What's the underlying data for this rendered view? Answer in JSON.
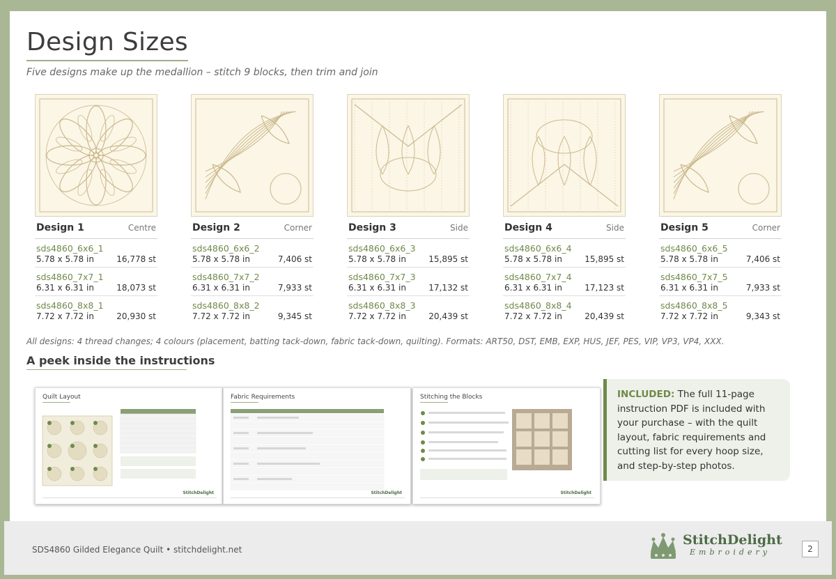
{
  "page": {
    "title": "Design Sizes",
    "subtitle": "Five designs make up the medallion – stitch 9 blocks, then trim and join"
  },
  "designs": [
    {
      "name": "Design 1",
      "role": "Centre",
      "sizes": [
        {
          "code": "sds4860_6x6_1",
          "dims": "5.78 x 5.78 in",
          "stitches": "16,778 st"
        },
        {
          "code": "sds4860_7x7_1",
          "dims": "6.31 x 6.31 in",
          "stitches": "18,073 st"
        },
        {
          "code": "sds4860_8x8_1",
          "dims": "7.72 x 7.72 in",
          "stitches": "20,930 st"
        }
      ]
    },
    {
      "name": "Design 2",
      "role": "Corner",
      "sizes": [
        {
          "code": "sds4860_6x6_2",
          "dims": "5.78 x 5.78 in",
          "stitches": "7,406 st"
        },
        {
          "code": "sds4860_7x7_2",
          "dims": "6.31 x 6.31 in",
          "stitches": "7,933 st"
        },
        {
          "code": "sds4860_8x8_2",
          "dims": "7.72 x 7.72 in",
          "stitches": "9,345 st"
        }
      ]
    },
    {
      "name": "Design 3",
      "role": "Side",
      "sizes": [
        {
          "code": "sds4860_6x6_3",
          "dims": "5.78 x 5.78 in",
          "stitches": "15,895 st"
        },
        {
          "code": "sds4860_7x7_3",
          "dims": "6.31 x 6.31 in",
          "stitches": "17,132 st"
        },
        {
          "code": "sds4860_8x8_3",
          "dims": "7.72 x 7.72 in",
          "stitches": "20,439 st"
        }
      ]
    },
    {
      "name": "Design 4",
      "role": "Side",
      "sizes": [
        {
          "code": "sds4860_6x6_4",
          "dims": "5.78 x 5.78 in",
          "stitches": "15,895 st"
        },
        {
          "code": "sds4860_7x7_4",
          "dims": "6.31 x 6.31 in",
          "stitches": "17,123 st"
        },
        {
          "code": "sds4860_8x8_4",
          "dims": "7.72 x 7.72 in",
          "stitches": "20,439 st"
        }
      ]
    },
    {
      "name": "Design 5",
      "role": "Corner",
      "sizes": [
        {
          "code": "sds4860_6x6_5",
          "dims": "5.78 x 5.78 in",
          "stitches": "7,406 st"
        },
        {
          "code": "sds4860_7x7_5",
          "dims": "6.31 x 6.31 in",
          "stitches": "7,933 st"
        },
        {
          "code": "sds4860_8x8_5",
          "dims": "7.72 x 7.72 in",
          "stitches": "9,343 st"
        }
      ]
    }
  ],
  "note": "All designs: 4 thread changes; 4 colours (placement, batting tack-down, fabric tack-down, quilting).  Formats: ART50, DST, EMB, EXP, HUS, JEF, PES, VIP, VP3, VP4, XXX.",
  "peek": {
    "title": "A peek inside the instructions",
    "previews": [
      "Quilt Layout",
      "Fabric Requirements",
      "Stitching the Blocks"
    ]
  },
  "included": {
    "label": "INCLUDED:",
    "text": " The full 11-page instruction PDF is included with your purchase – with the quilt layout, fabric requirements and cutting list for every hoop size, and step-by-step photos."
  },
  "footer": {
    "text": "SDS4860 Gilded Elegance Quilt  •  stitchdelight.net",
    "logo_main": "StitchDelight",
    "logo_sub": "Embroidery",
    "page_number": "2"
  },
  "colors": {
    "accent": "#6f8a4a",
    "border": "#a9b795",
    "thumb_bg": "#fbf6e6",
    "thumb_line": "#cbb98d"
  }
}
